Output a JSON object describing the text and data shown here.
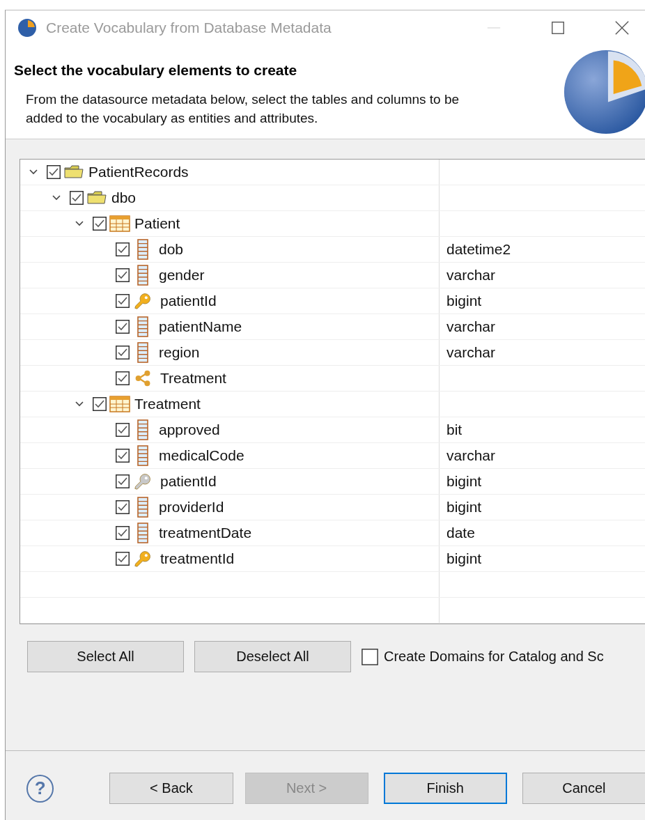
{
  "window": {
    "title": "Create Vocabulary from Database Metadata"
  },
  "header": {
    "title": "Select the vocabulary elements to create",
    "description": "From the datasource metadata below, select the tables and columns to be added to the vocabulary as entities and attributes."
  },
  "tree": [
    {
      "kind": "folder",
      "label": "PatientRecords",
      "checked": true,
      "expanded": true,
      "children": [
        {
          "kind": "folder",
          "label": "dbo",
          "checked": true,
          "expanded": true,
          "children": [
            {
              "kind": "table",
              "label": "Patient",
              "checked": true,
              "expanded": true,
              "children": [
                {
                  "kind": "column",
                  "label": "dob",
                  "type": "datetime2",
                  "checked": true
                },
                {
                  "kind": "column",
                  "label": "gender",
                  "type": "varchar",
                  "checked": true
                },
                {
                  "kind": "primary-key",
                  "label": "patientId",
                  "type": "bigint",
                  "checked": true
                },
                {
                  "kind": "column",
                  "label": "patientName",
                  "type": "varchar",
                  "checked": true
                },
                {
                  "kind": "column",
                  "label": "region",
                  "type": "varchar",
                  "checked": true
                },
                {
                  "kind": "relation",
                  "label": "Treatment",
                  "checked": true
                }
              ]
            },
            {
              "kind": "table",
              "label": "Treatment",
              "checked": true,
              "expanded": true,
              "children": [
                {
                  "kind": "column",
                  "label": "approved",
                  "type": "bit",
                  "checked": true
                },
                {
                  "kind": "column",
                  "label": "medicalCode",
                  "type": "varchar",
                  "checked": true
                },
                {
                  "kind": "foreign-key",
                  "label": "patientId",
                  "type": "bigint",
                  "checked": true
                },
                {
                  "kind": "column",
                  "label": "providerId",
                  "type": "bigint",
                  "checked": true
                },
                {
                  "kind": "column",
                  "label": "treatmentDate",
                  "type": "date",
                  "checked": true
                },
                {
                  "kind": "primary-key",
                  "label": "treatmentId",
                  "type": "bigint",
                  "checked": true
                }
              ]
            }
          ]
        }
      ]
    }
  ],
  "tree_buttons": [
    {
      "label": "Select All"
    },
    {
      "label": "Deselect All"
    }
  ],
  "domains_option": {
    "label": "Create Domains for Catalog and Sc",
    "checked": false
  },
  "help": {
    "label": "?"
  },
  "buttons": [
    {
      "label": "< Back",
      "disabled": false,
      "default": false
    },
    {
      "label": "Next >",
      "disabled": true,
      "default": false
    },
    {
      "label": "Finish",
      "disabled": false,
      "default": true
    },
    {
      "label": "Cancel",
      "disabled": false,
      "default": false
    }
  ]
}
